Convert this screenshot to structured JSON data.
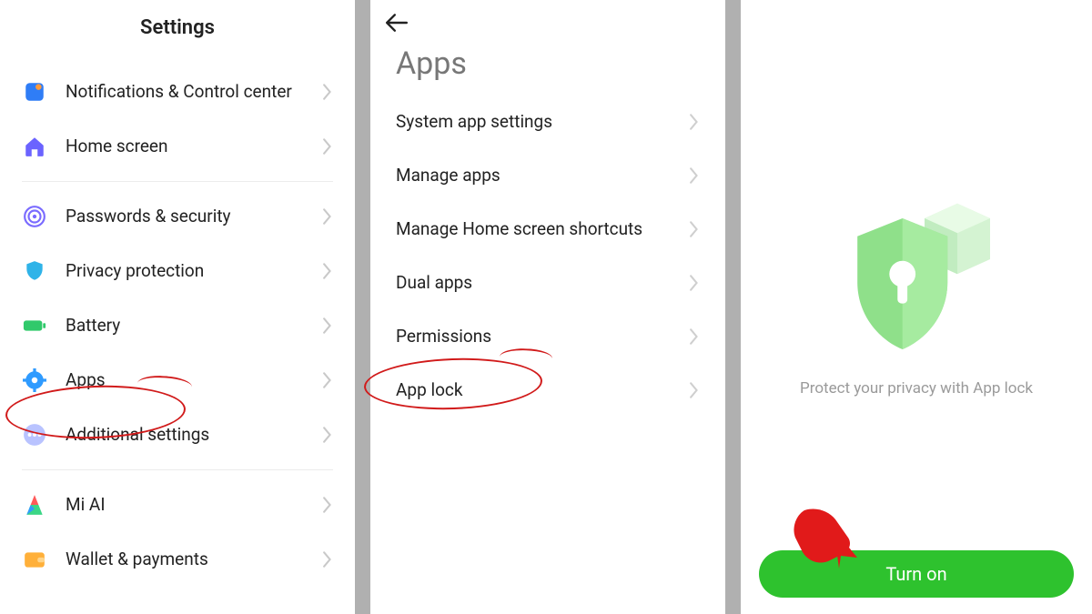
{
  "panel1": {
    "title": "Settings",
    "items": [
      {
        "label": "Notifications & Control center",
        "icon": "notifications"
      },
      {
        "label": "Home screen",
        "icon": "home"
      },
      {
        "label": "Passwords & security",
        "icon": "fingerprint"
      },
      {
        "label": "Privacy protection",
        "icon": "shield-small"
      },
      {
        "label": "Battery",
        "icon": "battery"
      },
      {
        "label": "Apps",
        "icon": "gear",
        "highlighted": true
      },
      {
        "label": "Additional settings",
        "icon": "dots"
      },
      {
        "label": "Mi AI",
        "icon": "mi-ai"
      },
      {
        "label": "Wallet & payments",
        "icon": "wallet"
      }
    ]
  },
  "panel2": {
    "title": "Apps",
    "items": [
      {
        "label": "System app settings"
      },
      {
        "label": "Manage apps"
      },
      {
        "label": "Manage Home screen shortcuts"
      },
      {
        "label": "Dual apps"
      },
      {
        "label": "Permissions"
      },
      {
        "label": "App lock",
        "highlighted": true
      }
    ]
  },
  "panel3": {
    "caption": "Protect your privacy with App lock",
    "button": "Turn on"
  },
  "colors": {
    "accent_green": "#2ec22e",
    "annotation_red": "#d11a1a"
  }
}
